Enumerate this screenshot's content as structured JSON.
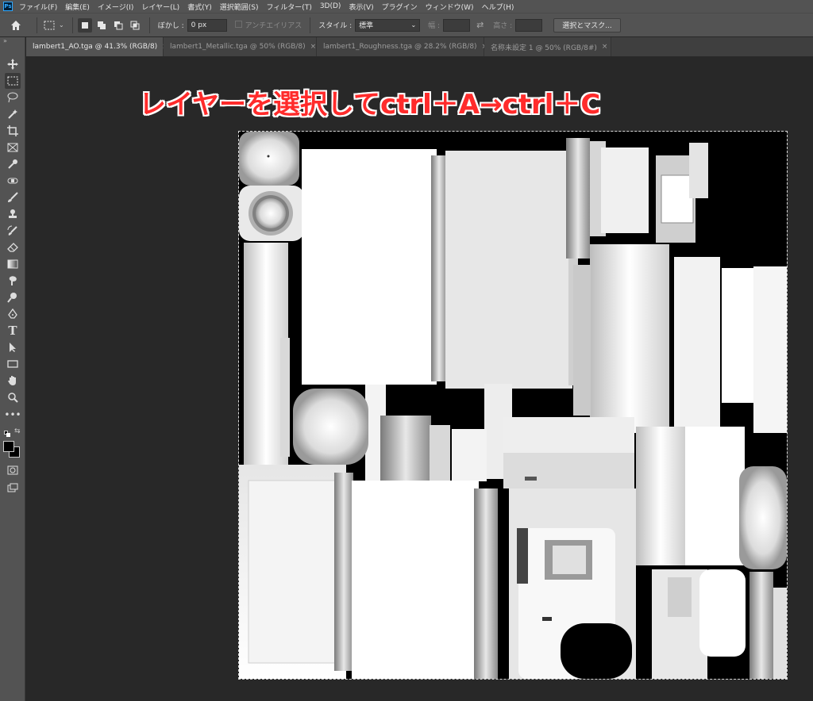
{
  "menubar": {
    "logo": "Ps",
    "items": [
      "ファイル(F)",
      "編集(E)",
      "イメージ(I)",
      "レイヤー(L)",
      "書式(Y)",
      "選択範囲(S)",
      "フィルター(T)",
      "3D(D)",
      "表示(V)",
      "プラグイン",
      "ウィンドウ(W)",
      "ヘルプ(H)"
    ]
  },
  "options": {
    "feather_label": "ぼかし :",
    "feather_value": "0 px",
    "antialias_label": "アンチエイリアス",
    "style_label": "スタイル :",
    "style_value": "標準",
    "width_label": "幅 :",
    "height_label": "高さ :",
    "select_mask_button": "選択とマスク..."
  },
  "tabs": [
    {
      "label": "lambert1_AO.tga @ 41.3% (RGB/8)",
      "active": true
    },
    {
      "label": "lambert1_Metallic.tga @ 50% (RGB/8)",
      "active": false
    },
    {
      "label": "lambert1_Roughness.tga @ 28.2% (RGB/8)",
      "active": false
    },
    {
      "label": "名称未設定 1 @ 50% (RGB/8#)",
      "active": false
    }
  ],
  "annotation": "レイヤーを選択してctrl＋A→ctrl＋C",
  "colors": {
    "foreground": "#000000",
    "background": "#ffffff",
    "annotation": "#ff2b2b",
    "ui_panel": "#535353"
  }
}
